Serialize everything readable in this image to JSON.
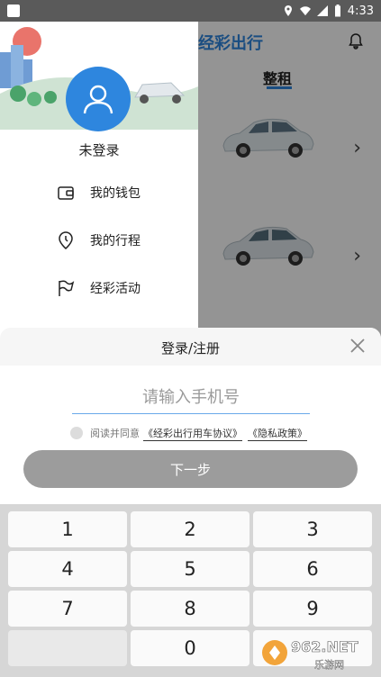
{
  "status_bar": {
    "time": "4:33"
  },
  "app": {
    "brand": "经彩出行",
    "tab": "整租"
  },
  "drawer": {
    "login_state": "未登录",
    "menu": [
      {
        "label": "我的钱包",
        "icon": "wallet-icon"
      },
      {
        "label": "我的行程",
        "icon": "location-pin-icon"
      },
      {
        "label": "经彩活动",
        "icon": "flag-icon"
      }
    ]
  },
  "sheet": {
    "title": "登录/注册",
    "phone_placeholder": "请输入手机号",
    "agree_text": "阅读并同意",
    "agreement_link": "《经彩出行用车协议》",
    "privacy_link": "《隐私政策》",
    "next_label": "下一步"
  },
  "keypad": {
    "keys": [
      "1",
      "2",
      "3",
      "4",
      "5",
      "6",
      "7",
      "8",
      "9",
      "",
      "0",
      ""
    ]
  },
  "watermark": {
    "site": "962.NET",
    "caption": "乐游网"
  },
  "colors": {
    "accent": "#2e86de",
    "button_disabled": "#9c9c9c"
  }
}
